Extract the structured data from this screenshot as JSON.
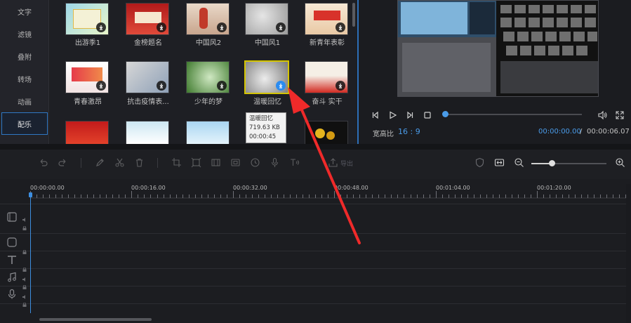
{
  "sidebar": {
    "items": [
      {
        "label": "文字"
      },
      {
        "label": "滤镜"
      },
      {
        "label": "叠附"
      },
      {
        "label": "转场"
      },
      {
        "label": "动画"
      },
      {
        "label": "配乐"
      }
    ],
    "active_index": 5
  },
  "media": {
    "rows": [
      [
        {
          "label": "出游季1"
        },
        {
          "label": "金榜题名"
        },
        {
          "label": "中国风2"
        },
        {
          "label": "中国风1"
        },
        {
          "label": "新青年表彰"
        }
      ],
      [
        {
          "label": "青春激昂"
        },
        {
          "label": "抗击疫情表..."
        },
        {
          "label": "少年的梦"
        },
        {
          "label": "温暖回忆"
        },
        {
          "label": "奋斗 实干"
        }
      ]
    ],
    "thumbnail_texts": {
      "tile_1": "某某出游\n精彩瞬间",
      "tile_2": "励志一起题名\n青春无悔",
      "tile_5": "新青年表彰",
      "tile_6": "青春激昂\n燃烧梦想",
      "tile_10": "奋斗实干"
    },
    "tooltip": {
      "name": "温暖回忆",
      "size": "719.63 KB",
      "duration": "00:00:45"
    }
  },
  "preview": {
    "ratio_label": "宽高比",
    "ratio_value": "16 : 9",
    "current_time": "00:00:00.00",
    "separator": "/",
    "total_time": "00:00:06.07",
    "progress": 0
  },
  "toolbar": {
    "export_label": "导出"
  },
  "timeline": {
    "ruler_labels": [
      "00:00:00.00",
      "00:00:16.00",
      "00:00:32.00",
      "00:00:48.00",
      "00:01:04.00",
      "00:01:20.00"
    ]
  },
  "colors": {
    "accent": "#2b8cf0",
    "selection": "#d4c400",
    "annotation_arrow": "#ef2a2a"
  }
}
